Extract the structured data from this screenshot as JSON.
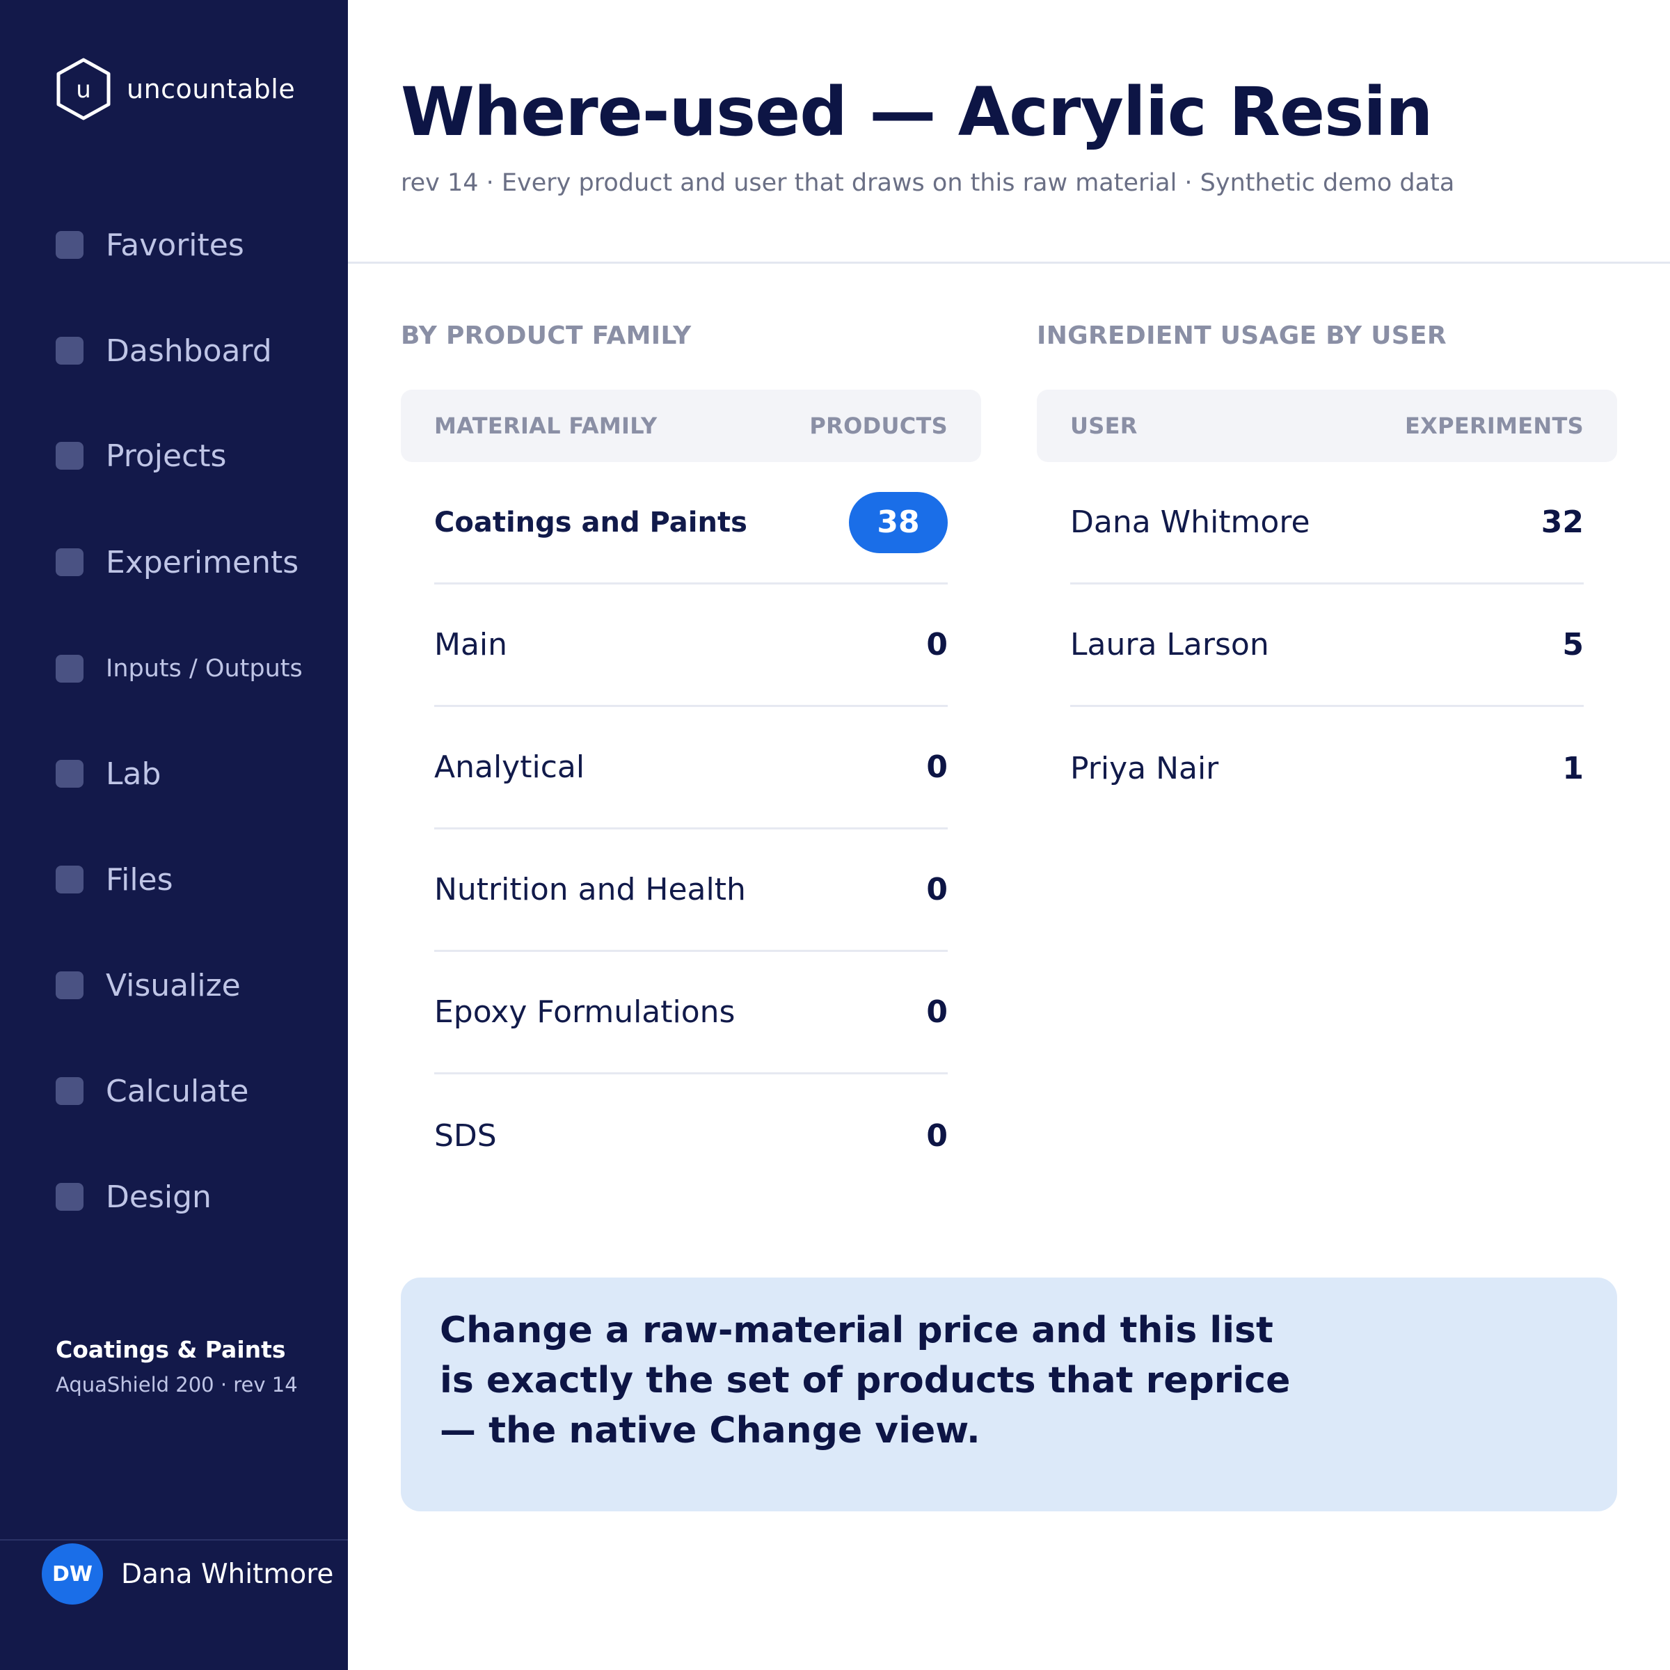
{
  "app": {
    "logo_letter": "u",
    "name": "uncountable"
  },
  "sidebar": {
    "items": [
      {
        "label": "Favorites"
      },
      {
        "label": "Dashboard"
      },
      {
        "label": "Projects"
      },
      {
        "label": "Experiments"
      },
      {
        "label": "Inputs / Outputs"
      },
      {
        "label": "Lab"
      },
      {
        "label": "Files"
      },
      {
        "label": "Visualize"
      },
      {
        "label": "Calculate"
      },
      {
        "label": "Design"
      }
    ],
    "context": {
      "title": "Coatings & Paints",
      "subtitle": "AquaShield 200 · rev 14"
    },
    "user": {
      "initials": "DW",
      "name": "Dana Whitmore"
    }
  },
  "header": {
    "title": "Where-used — Acrylic Resin",
    "subtitle": "rev 14 · Every product and user that draws on this raw material · Synthetic demo data"
  },
  "product_family": {
    "section_title": "BY PRODUCT FAMILY",
    "columns": [
      "MATERIAL FAMILY",
      "PRODUCTS"
    ],
    "rows": [
      {
        "name": "Coatings and Paints",
        "value": "38",
        "highlighted": true
      },
      {
        "name": "Main",
        "value": "0"
      },
      {
        "name": "Analytical",
        "value": "0"
      },
      {
        "name": "Nutrition and Health",
        "value": "0"
      },
      {
        "name": "Epoxy Formulations",
        "value": "0"
      },
      {
        "name": "SDS",
        "value": "0"
      }
    ]
  },
  "user_usage": {
    "section_title": "INGREDIENT USAGE BY USER",
    "columns": [
      "USER",
      "EXPERIMENTS"
    ],
    "rows": [
      {
        "name": "Dana Whitmore",
        "value": "32"
      },
      {
        "name": "Laura Larson",
        "value": "5"
      },
      {
        "name": "Priya Nair",
        "value": "1"
      }
    ]
  },
  "callout": {
    "text": "Change a raw-material price and this list is exactly the set of products that reprice — the native Change view."
  },
  "colors": {
    "sidebar_bg": "#13194a",
    "accent": "#1a6ee8",
    "callout_bg": "#dce9f9",
    "heading": "#0d1545",
    "muted": "#8a8fa5"
  },
  "icons": {
    "logo": "hexagon-logo-icon",
    "nav_bullet": "rounded-square-icon"
  }
}
